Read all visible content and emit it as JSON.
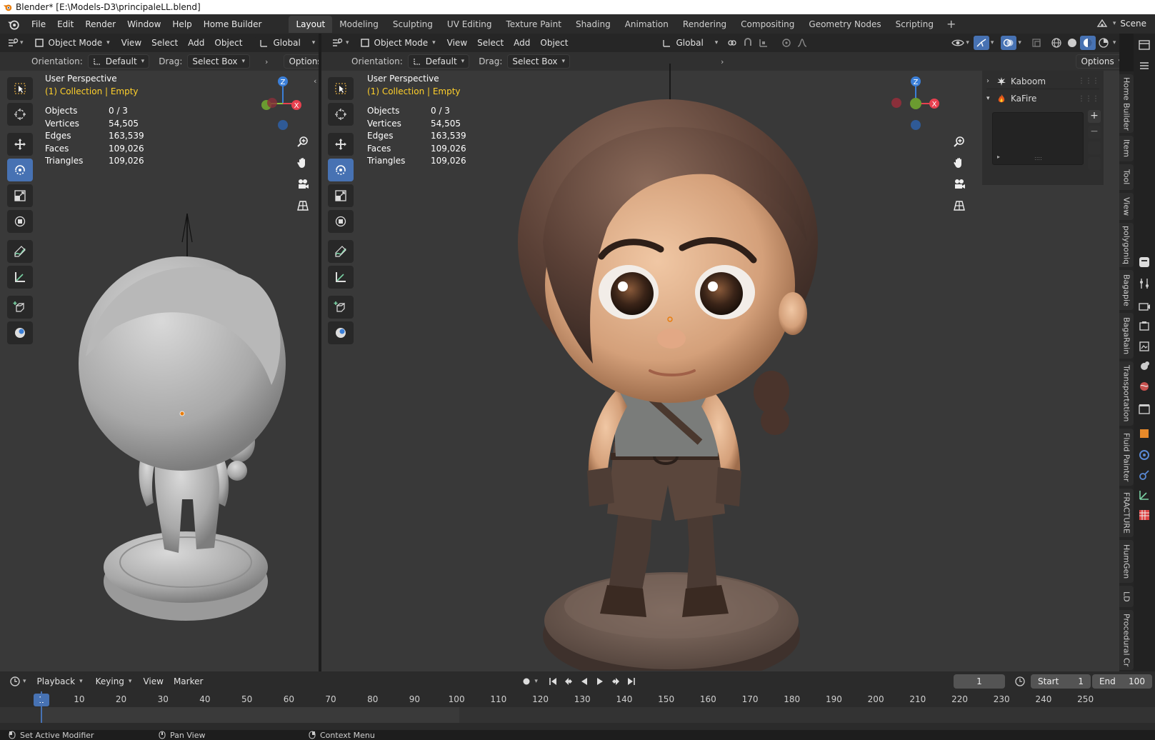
{
  "window": {
    "title": "Blender* [E:\\Models-D3\\principaleLL.blend]"
  },
  "menu": [
    "File",
    "Edit",
    "Render",
    "Window",
    "Help",
    "Home Builder"
  ],
  "workspaces": [
    "Layout",
    "Modeling",
    "Sculpting",
    "UV Editing",
    "Texture Paint",
    "Shading",
    "Animation",
    "Rendering",
    "Compositing",
    "Geometry Nodes",
    "Scripting"
  ],
  "active_workspace": "Layout",
  "scene": {
    "label": "Scene"
  },
  "left_view": {
    "mode": "Object Mode",
    "menus": [
      "View",
      "Select",
      "Add",
      "Object"
    ],
    "transform": "Global",
    "orientation_label": "Orientation:",
    "orientation_value": "Default",
    "drag_label": "Drag:",
    "drag_value": "Select Box",
    "options": "Options",
    "overlay_title": "User Perspective",
    "collection": "(1) Collection | Empty",
    "stats": [
      {
        "k": "Objects",
        "v": "0 / 3"
      },
      {
        "k": "Vertices",
        "v": "54,505"
      },
      {
        "k": "Edges",
        "v": "163,539"
      },
      {
        "k": "Faces",
        "v": "109,026"
      },
      {
        "k": "Triangles",
        "v": "109,026"
      }
    ]
  },
  "right_view": {
    "mode": "Object Mode",
    "menus": [
      "View",
      "Select",
      "Add",
      "Object"
    ],
    "transform": "Global",
    "orientation_label": "Orientation:",
    "orientation_value": "Default",
    "drag_label": "Drag:",
    "drag_value": "Select Box",
    "options": "Options",
    "overlay_title": "User Perspective",
    "collection": "(1) Collection | Empty",
    "stats": [
      {
        "k": "Objects",
        "v": "0 / 3"
      },
      {
        "k": "Vertices",
        "v": "54,505"
      },
      {
        "k": "Edges",
        "v": "163,539"
      },
      {
        "k": "Faces",
        "v": "109,026"
      },
      {
        "k": "Triangles",
        "v": "109,026"
      }
    ]
  },
  "gizmo_axes": {
    "x": "X",
    "z": "Z"
  },
  "n_panel": {
    "items": [
      {
        "label": "Kaboom",
        "expanded": false
      },
      {
        "label": "KaFire",
        "expanded": true
      }
    ]
  },
  "side_tabs": [
    "Home Builder",
    "Item",
    "Tool",
    "View",
    "polygoniq",
    "Bagapie",
    "BagaRain",
    "Transportation",
    "Fluid Painter",
    "FRACTURE",
    "HumGen",
    "LD",
    "Procedural Cr"
  ],
  "timeline": {
    "menus": [
      "Playback",
      "Keying",
      "View",
      "Marker"
    ],
    "current_frame": "1",
    "start_label": "Start",
    "start": "1",
    "end_label": "End",
    "end": "100",
    "ticks": [
      "10",
      "20",
      "30",
      "40",
      "50",
      "60",
      "70",
      "80",
      "90",
      "100",
      "110",
      "120",
      "130",
      "140",
      "150",
      "160",
      "170",
      "180",
      "190",
      "200",
      "210",
      "220",
      "230",
      "240",
      "250"
    ],
    "indicator": "1"
  },
  "status": {
    "left": "Set Active Modifier",
    "middle": "Pan View",
    "right": "Context Menu"
  },
  "colors": {
    "accent": "#4772b3",
    "collection_text": "#ffd02b",
    "axis_x": "#e8404f",
    "axis_y": "#8bc43f",
    "axis_z": "#3b7fd8"
  }
}
